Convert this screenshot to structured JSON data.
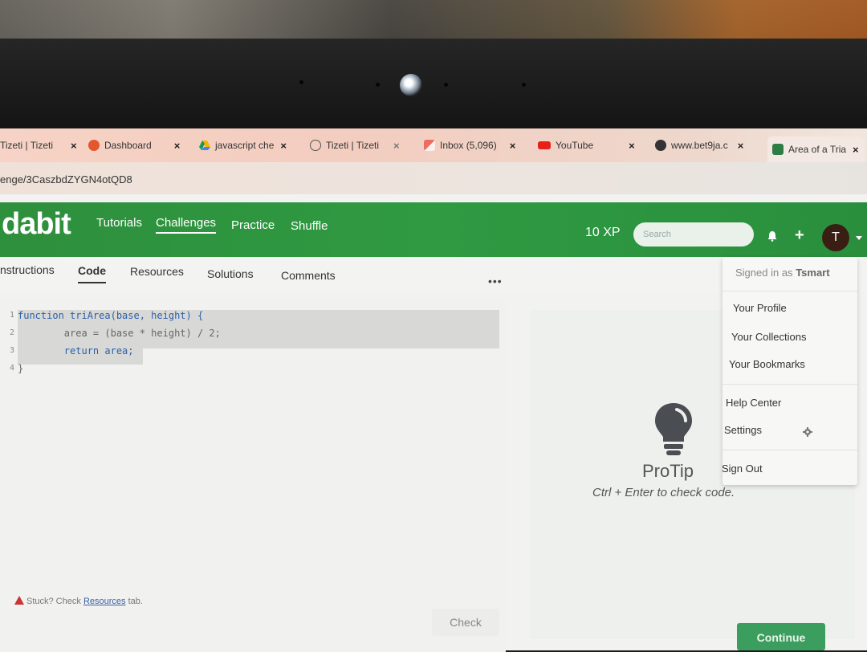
{
  "browser": {
    "tabs": [
      {
        "label": "Tizeti | Tizeti",
        "icon": "generic-page-icon"
      },
      {
        "label": "Dashboard",
        "icon": "office-icon"
      },
      {
        "label": "javascript che",
        "icon": "google-drive-icon"
      },
      {
        "label": "Tizeti | Tizeti",
        "icon": "tizeti-icon"
      },
      {
        "label": "Inbox (5,096)",
        "icon": "gmail-icon"
      },
      {
        "label": "YouTube",
        "icon": "youtube-icon"
      },
      {
        "label": "www.bet9ja.c",
        "icon": "globe-icon"
      },
      {
        "label": "Area of a Tria",
        "icon": "edabit-icon"
      }
    ],
    "close_glyph": "×",
    "address": "enge/3CaszbdZYGN4otQD8"
  },
  "site": {
    "logo": "dabit",
    "nav": [
      "Tutorials",
      "Challenges",
      "Practice",
      "Shuffle"
    ],
    "active_nav": "Challenges",
    "xp": "10 XP",
    "search_placeholder": "Search",
    "avatar_letter": "T",
    "brand_color": "#2f9a42"
  },
  "subtabs": {
    "items": [
      "nstructions",
      "Code",
      "Resources",
      "Solutions",
      "Comments"
    ],
    "active": "Code",
    "more": "•••"
  },
  "editor": {
    "line_numbers": [
      "1",
      "2",
      "3",
      "4"
    ],
    "lines": [
      "function triArea(base, height) {",
      "        area = (base * height) / 2;",
      "        return area;",
      "}"
    ]
  },
  "protip": {
    "title": "ProTip",
    "text": "Ctrl + Enter to check code."
  },
  "user_menu": {
    "signed_in_prefix": "Signed in as",
    "username": "Tsmart",
    "items": [
      "Your Profile",
      "Your Collections",
      "Your Bookmarks",
      "Help Center",
      "Settings",
      "Sign Out"
    ]
  },
  "footer": {
    "stuck_prefix": "Stuck? Check",
    "stuck_link": "Resources",
    "stuck_suffix": "tab.",
    "check_label": "Check",
    "continue_label": "Continue"
  }
}
